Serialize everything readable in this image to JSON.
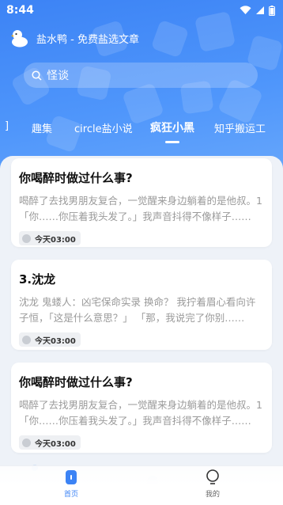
{
  "status_bar": {
    "time": "8:44"
  },
  "header": {
    "title": "盐水鸭 - 免费盐选文章"
  },
  "search": {
    "placeholder": "怪谈"
  },
  "tabs": [
    {
      "label": "]"
    },
    {
      "label": "趣集"
    },
    {
      "label": "circle盐小说"
    },
    {
      "label": "疯狂小黑"
    },
    {
      "label": "知乎搬运工"
    }
  ],
  "active_tab": "疯狂小黑",
  "cards": [
    {
      "title": "你喝醉时做过什么事?",
      "snippet": "喝醉了去找男朋友复合，一觉醒来身边躺着的是他叔。1「你……你压着我头发了。」我声音抖得不像样子……",
      "time": "今天03:00"
    },
    {
      "title": "3.沈龙",
      "snippet": "沈龙 鬼蝼人：凶宅保命实录 换命？ 我拧着眉心看向许子恒，「这是什么意思？」 「那，我说完了你别……",
      "time": "今天03:00"
    },
    {
      "title": "你喝醉时做过什么事?",
      "snippet": "喝醉了去找男朋友复合，一觉醒来身边躺着的是他叔。1「你……你压着我头发了。」我声音抖得不像样子……",
      "time": "今天03:00"
    }
  ],
  "bottom_nav": [
    {
      "label": "首页",
      "icon": "home-icon",
      "active": true
    },
    {
      "label": "我的",
      "icon": "lightbulb-icon",
      "active": false
    }
  ],
  "colors": {
    "primary": "#3c83f5",
    "background": "#eef2f8",
    "text_muted": "#9a9a9a"
  }
}
